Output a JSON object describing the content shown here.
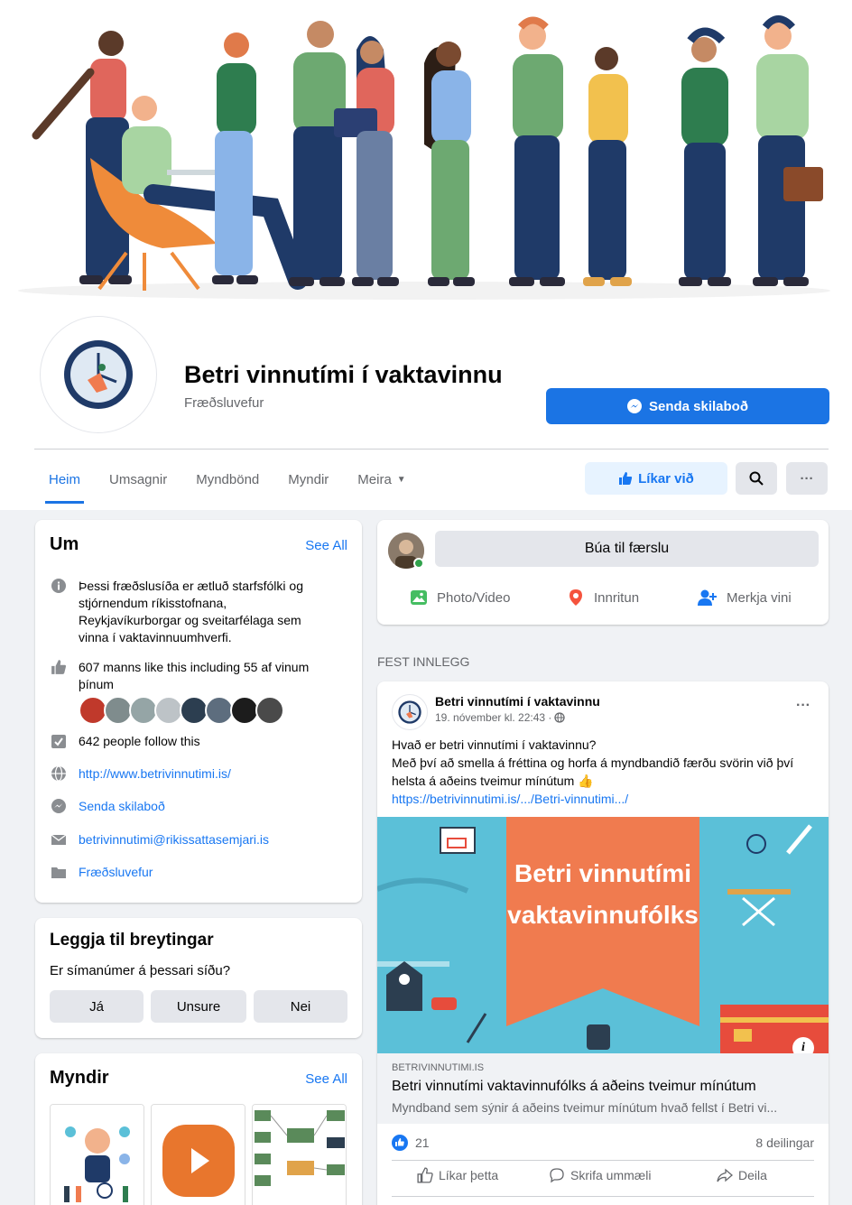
{
  "page": {
    "title": "Betri vinnutími í vaktavinnu",
    "category": "Fræðsluvefur",
    "send_message_label": "Senda skilaboð",
    "like_label": "Líkar við",
    "more_icon": "···"
  },
  "tabs": [
    {
      "label": "Heim",
      "active": true
    },
    {
      "label": "Umsagnir",
      "active": false
    },
    {
      "label": "Myndbönd",
      "active": false
    },
    {
      "label": "Myndir",
      "active": false
    },
    {
      "label": "Meira",
      "active": false
    }
  ],
  "about": {
    "title": "Um",
    "see_all": "See All",
    "description": "Þessi fræðslusíða er ætluð starfsfólki og stjórnendum ríkisstofnana, Reykjavíkurborgar og sveitarfélaga sem vinna í vaktavinnuumhverfi.",
    "likes": "607 manns like this including 55 af vinum þínum",
    "followers": "642 people follow this",
    "website": "http://www.betrivinnutimi.is/",
    "send_message": "Senda skilaboð",
    "email": "betrivinnutimi@rikissattasemjari.is",
    "category": "Fræðsluvefur"
  },
  "suggest": {
    "title": "Leggja til breytingar",
    "question": "Er símanúmer á þessari síðu?",
    "yes": "Já",
    "unsure": "Unsure",
    "no": "Nei"
  },
  "photos": {
    "title": "Myndir",
    "see_all": "See All"
  },
  "composer": {
    "placeholder": "Búa til færslu",
    "photo_video": "Photo/Video",
    "checkin": "Innritun",
    "tag_friends": "Merkja vini"
  },
  "pinned": {
    "section_label": "FEST INNLEGG",
    "author": "Betri vinnutími í vaktavinnu",
    "date": "19. nóvember kl. 22:43 ·",
    "text_line1": "Hvað er betri vinnutími í vaktavinnu?",
    "text_line2": "Með því að smella á fréttina og horfa á myndbandið færðu svörin við því helsta á aðeins tveimur mínútum 👍",
    "link": "https://betrivinnutimi.is/.../Betri-vinnutimi.../",
    "banner_line1": "Betri vinnutími",
    "banner_line2": "vaktavinnufólks",
    "link_domain": "BETRIVINNUTIMI.IS",
    "link_title": "Betri vinnutími vaktavinnufólks á aðeins tveimur mínútum",
    "link_desc": "Myndband sem sýnir á aðeins tveimur mínútum hvað fellst í Betri vi...",
    "reactions": "21",
    "shares": "8 deilingar",
    "like_action": "Líkar þetta",
    "comment_action": "Skrifa ummæli",
    "share_action": "Deila"
  },
  "colors": {
    "accent": "#1b74e4",
    "background": "#f0f2f5",
    "banner_blue": "#5bc0d8",
    "banner_orange": "#f07b4f"
  }
}
